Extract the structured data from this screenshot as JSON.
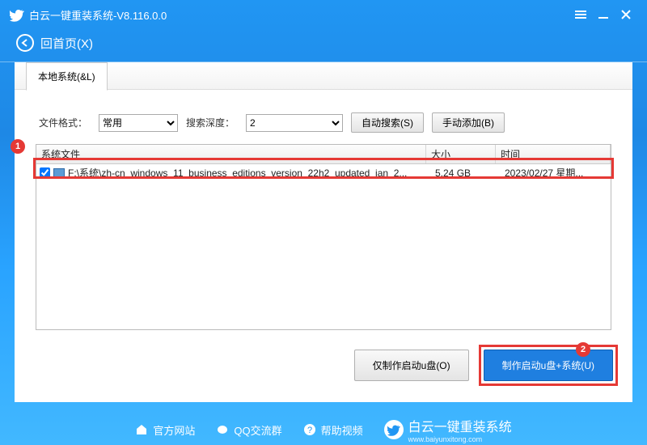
{
  "titlebar": {
    "title": "白云一键重装系统-V8.116.0.0"
  },
  "back": {
    "label": "回首页(X)"
  },
  "tab": {
    "local": "本地系统(&L)"
  },
  "controls": {
    "format_label": "文件格式：",
    "format_value": "常用",
    "depth_label": "搜索深度：",
    "depth_value": "2",
    "auto_search": "自动搜索(S)",
    "manual_add": "手动添加(B)"
  },
  "table": {
    "headers": {
      "file": "系统文件",
      "size": "大小",
      "time": "时间"
    },
    "rows": [
      {
        "checked": true,
        "path": "F:\\系统\\zh-cn_windows_11_business_editions_version_22h2_updated_jan_2...",
        "size": "5.24 GB",
        "time": "2023/02/27 星期..."
      }
    ]
  },
  "bottom": {
    "make_only": "仅制作启动u盘(O)",
    "make_system": "制作启动u盘+系统(U)"
  },
  "markers": {
    "one": "1",
    "two": "2"
  },
  "footer": {
    "site": "官方网站",
    "qq": "QQ交流群",
    "help": "帮助视频",
    "brand": "白云一键重装系统",
    "url": "www.baiyunxitong.com"
  }
}
